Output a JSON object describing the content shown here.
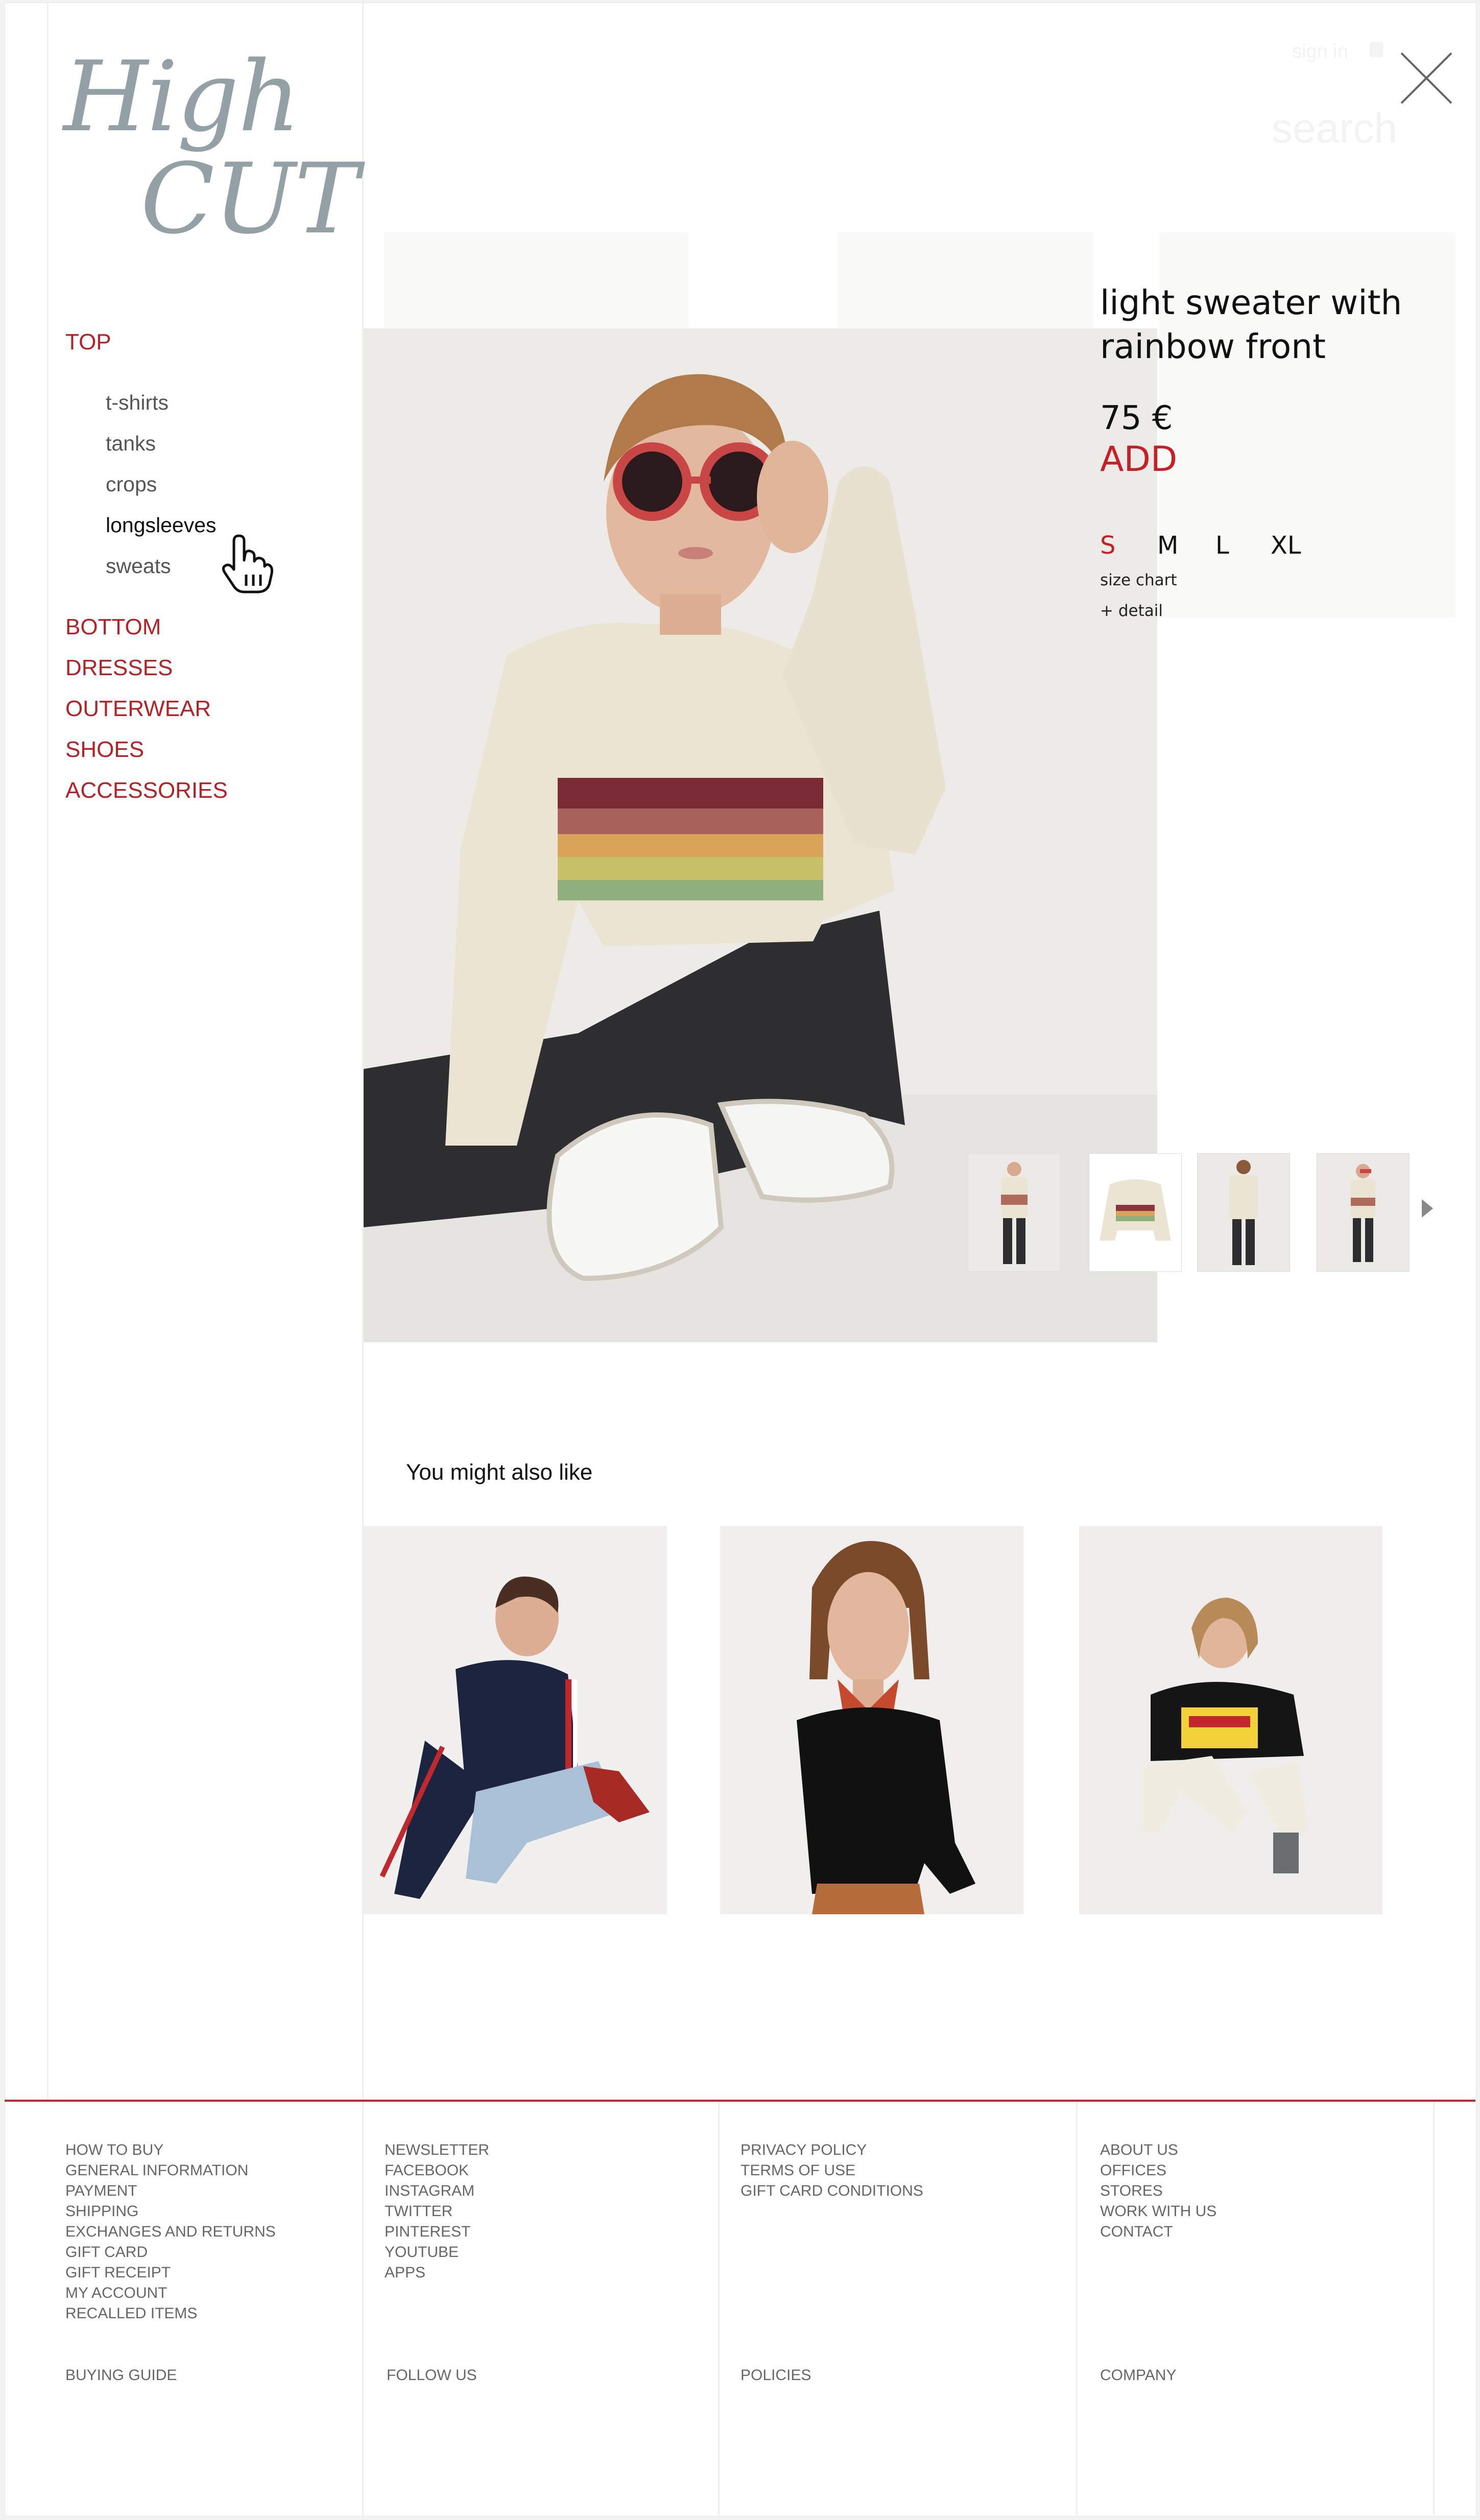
{
  "brand": {
    "logo_line1": "High",
    "logo_line2": "CUT"
  },
  "header": {
    "sign_in": "sign in",
    "search": "search"
  },
  "nav": {
    "top": "TOP",
    "sub": [
      "t-shirts",
      "tanks",
      "crops",
      "longsleeves",
      "sweats"
    ],
    "categories": [
      "BOTTOM",
      "DRESSES",
      "OUTERWEAR",
      "SHOES",
      "ACCESSORIES"
    ]
  },
  "product": {
    "title": "light sweater with rainbow front",
    "price": "75 €",
    "add": "ADD",
    "sizes": [
      "S",
      "M",
      "L",
      "XL"
    ],
    "selected_size": "S",
    "size_chart": "size chart",
    "detail": "+ detail"
  },
  "recommendations": {
    "heading": "You might also like"
  },
  "footer": {
    "col1": [
      "HOW TO BUY",
      "GENERAL INFORMATION",
      "PAYMENT",
      "SHIPPING",
      "EXCHANGES AND RETURNS",
      "GIFT CARD",
      "GIFT RECEIPT",
      "MY ACCOUNT",
      "RECALLED ITEMS"
    ],
    "col2": [
      "NEWSLETTER",
      "FACEBOOK",
      "INSTAGRAM",
      "TWITTER",
      "PINTEREST",
      "YOUTUBE",
      "APPS"
    ],
    "col3": [
      "PRIVACY POLICY",
      "TERMS OF USE",
      "GIFT CARD CONDITIONS"
    ],
    "col4": [
      "ABOUT US",
      "OFFICES",
      "STORES",
      "WORK WITH US",
      "CONTACT"
    ],
    "headings": [
      "BUYING GUIDE",
      "FOLLOW US",
      "POLICIES",
      "COMPANY"
    ]
  },
  "colors": {
    "accent": "#c42026",
    "logo": "#93a0a6",
    "text": "#111111"
  },
  "icons": [
    "close-icon",
    "hand-cursor-icon",
    "arrow-right-icon",
    "user-icon"
  ]
}
